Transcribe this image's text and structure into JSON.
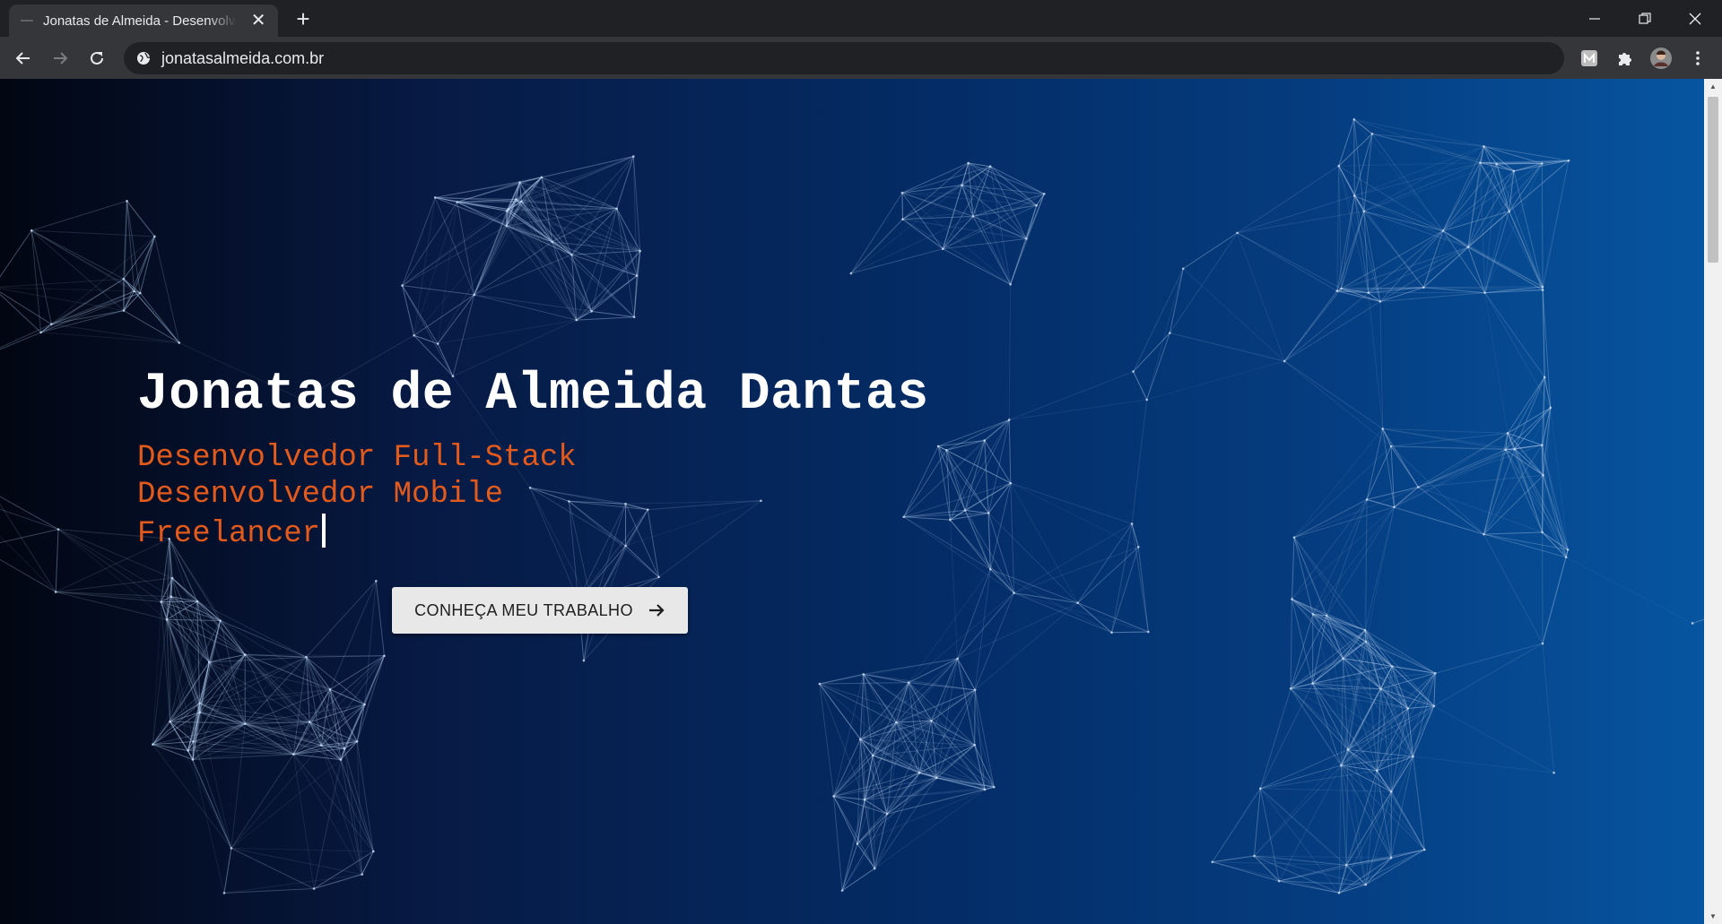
{
  "browser": {
    "tab_title": "Jonatas de Almeida - Desenvolvedor",
    "url": "jonatasalmeida.com.br",
    "tab_close_glyph": "✕",
    "new_tab_glyph": "+"
  },
  "icons": {
    "back": "back-arrow-icon",
    "forward": "forward-arrow-icon",
    "reload": "reload-icon",
    "site_info": "globe-icon",
    "extension_m": "m-extension-icon",
    "extensions": "puzzle-piece-icon",
    "profile": "profile-avatar-icon",
    "menu": "kebab-menu-icon",
    "cta_arrow": "arrow-right-icon"
  },
  "hero": {
    "name": "Jonatas de Almeida Dantas",
    "roles": [
      "Desenvolvedor Full-Stack",
      "Desenvolvedor Mobile",
      "Freelancer"
    ],
    "cta_label": "CONHEÇA MEU TRABALHO"
  },
  "colors": {
    "accent": "#e25a1c",
    "name": "#ffffff",
    "network_line": "#a9c4e6",
    "bg_left": "#020612",
    "bg_right": "#0655a0",
    "button_bg": "#e8e8e8"
  }
}
